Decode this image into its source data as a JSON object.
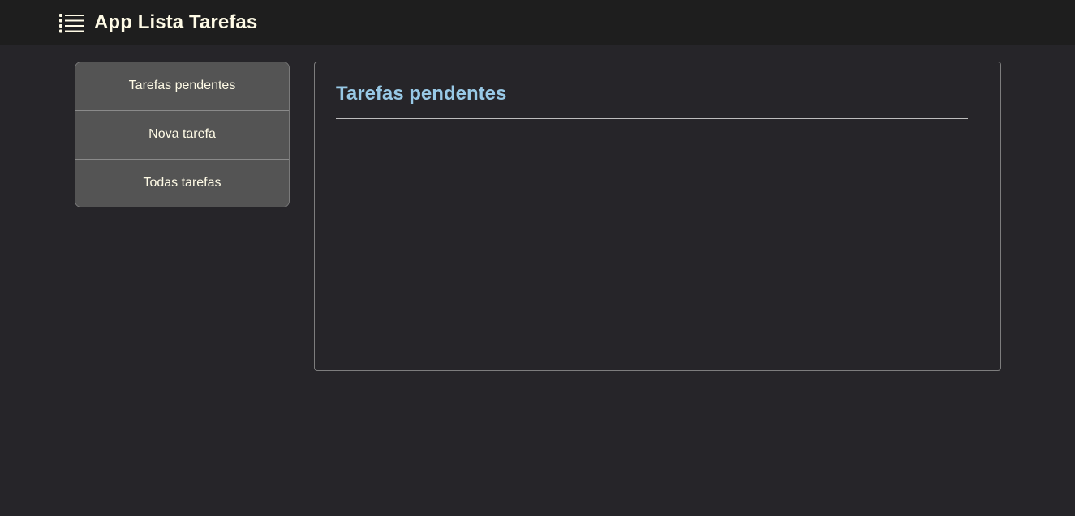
{
  "header": {
    "title": "App Lista Tarefas",
    "icon": "list-icon"
  },
  "sidebar": {
    "items": [
      {
        "label": "Tarefas pendentes"
      },
      {
        "label": "Nova tarefa"
      },
      {
        "label": "Todas tarefas"
      }
    ]
  },
  "main": {
    "title": "Tarefas pendentes",
    "tasks": []
  },
  "colors": {
    "background": "#262529",
    "topbar": "#1e1e1e",
    "menu_item": "#545454",
    "text": "#fffbe6",
    "heading_accent": "#98c9e6"
  }
}
